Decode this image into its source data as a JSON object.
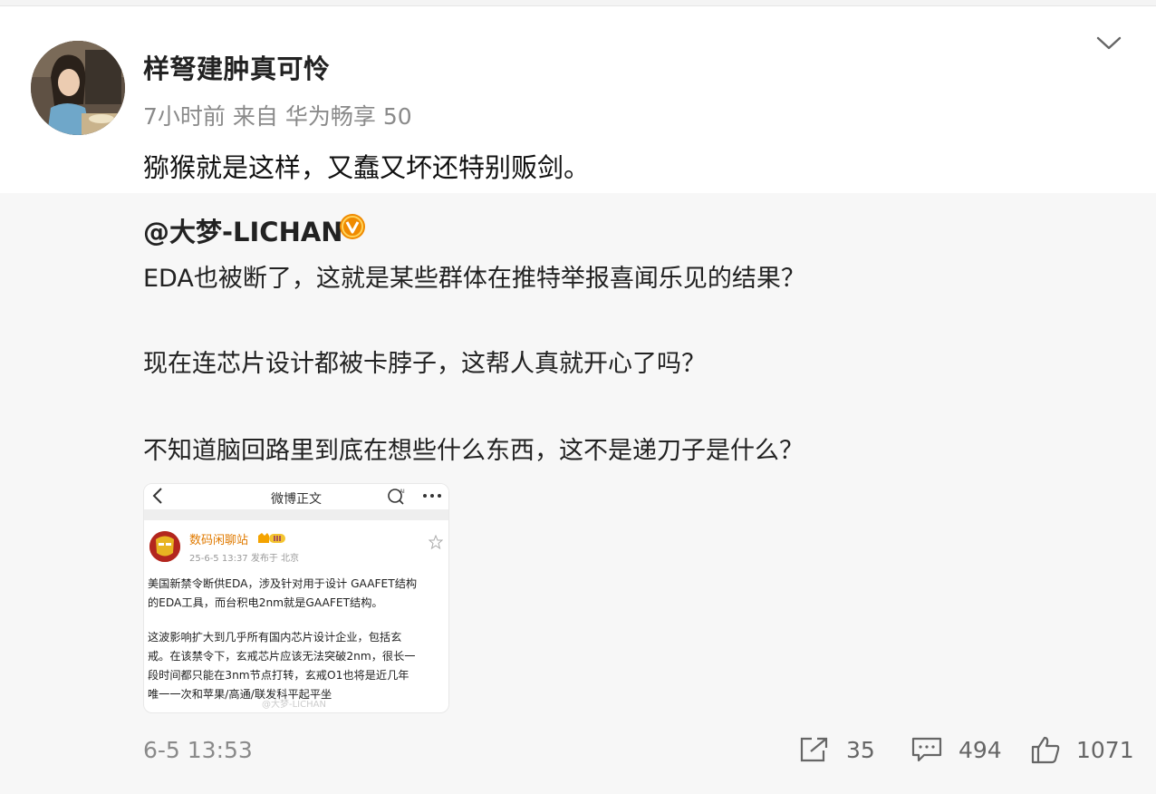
{
  "post": {
    "author": "样弩建肿真可怜",
    "time": "7小时前",
    "source_prefix": "来自",
    "device": "华为畅享 50",
    "text": "猕猴就是这样，又蠢又坏还特别贩剑。"
  },
  "repost": {
    "author": "@大梦-LICHAN",
    "paragraphs": [
      "EDA也被断了，这就是某些群体在推特举报喜闻乐见的结果？",
      "现在连芯片设计都被卡脖子，这帮人真就开心了吗？",
      "不知道脑回路里到底在想些什么东西，这不是递刀子是什么？"
    ],
    "image": {
      "nav_title": "微博正文",
      "name": "数码闲聊站",
      "meta": "25-6-5 13:37   发布于 北京",
      "lines": [
        "美国新禁令断供EDA，涉及针对用于设计 GAAFET结构",
        "的EDA工具，而台积电2nm就是GAAFET结构。",
        "",
        "这波影响扩大到几乎所有国内芯片设计企业，包括玄",
        "戒。在该禁令下，玄戒芯片应该无法突破2nm，很长一",
        "段时间都只能在3nm节点打转，玄戒O1也将是近几年",
        "唯一一次和苹果/高通/联发科平起平坐"
      ],
      "watermark": "@大梦-LICHAN"
    },
    "date": "6-5 13:53",
    "reposts": "35",
    "comments": "494",
    "likes": "1071"
  },
  "icons": {
    "more": "chevron-down-icon",
    "verified": "verified-badge-icon",
    "repost": "share-icon",
    "comment": "comment-icon",
    "like": "thumbs-up-icon"
  },
  "colors": {
    "verified": "#f08a00",
    "muted": "#8a8a8a",
    "repost_bg": "#f7f7f7"
  }
}
